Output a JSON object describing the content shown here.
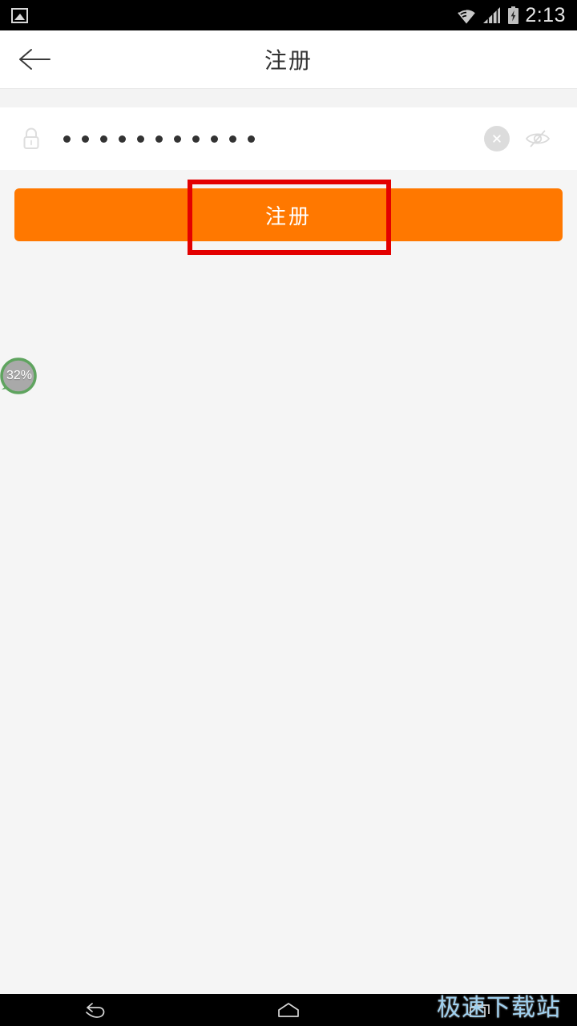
{
  "status_bar": {
    "notification_icon": "photo-icon",
    "wifi_icon": "wifi-icon",
    "signal_icon": "signal-bars-icon",
    "battery_icon": "battery-charging-icon",
    "time": "2:13"
  },
  "header": {
    "back_icon": "back-arrow-icon",
    "title": "注册"
  },
  "password_field": {
    "lock_icon": "lock-icon",
    "masked_value": "•••••••••••",
    "dot_count": 11,
    "clear_icon": "clear-circle-icon",
    "visibility_icon": "eye-off-icon"
  },
  "register_button": {
    "label": "注册",
    "color": "#ff7800",
    "text_color": "#ffffff"
  },
  "highlight": {
    "color": "#e30000",
    "target": "register-button"
  },
  "progress_badge": {
    "label": "32%",
    "ring_color": "#5fa45f",
    "fill_color": "#a9a9a9"
  },
  "watermark": {
    "text": "极速下载站",
    "color": "#9fd0ef"
  },
  "nav_bar": {
    "back_icon": "nav-back-icon",
    "home_icon": "nav-home-icon",
    "recents_icon": "nav-recents-icon"
  }
}
